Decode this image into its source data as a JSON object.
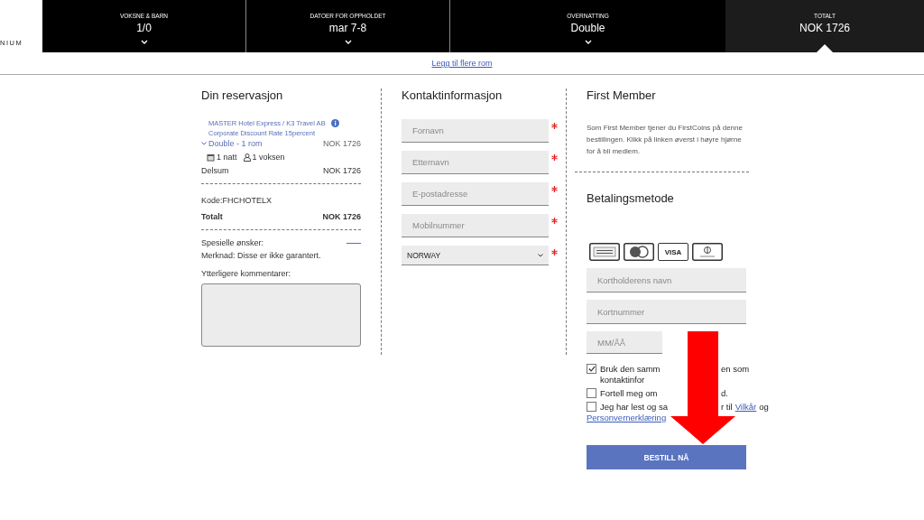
{
  "header": {
    "logo_text": "NIUM",
    "items": [
      {
        "label": "VOKSNE & BARN",
        "value": "1/0",
        "kind": "dropdown"
      },
      {
        "label": "DATOER FOR OPPHOLDET",
        "value": "mar 7-8",
        "kind": "dropdown"
      },
      {
        "label": "OVERNATTING",
        "value": "Double",
        "kind": "dropdown"
      },
      {
        "label": "TOTALT",
        "value": "NOK 1726",
        "kind": "total"
      }
    ]
  },
  "add_room_link": "Legg til flere rom",
  "reservation": {
    "title": "Din reservasjon",
    "rate_line_1": "MASTER Hotel Express / K3 Travel AB",
    "rate_line_2": "Corporate Discount Rate 15percent",
    "room": "Double - 1 rom",
    "room_price": "NOK 1726",
    "nights": "1 natt",
    "guests": "1 voksen",
    "subtotal_label": "Delsum",
    "subtotal": "NOK 1726",
    "code": "Kode:FHCHOTELX",
    "total_label": "Totalt",
    "total": "NOK 1726",
    "special_requests": "Spesielle ønsker:",
    "note": "Merknad: Disse er ikke garantert.",
    "comments_label": "Ytterligere kommentarer:"
  },
  "contact": {
    "title": "Kontaktinformasjon",
    "fields": [
      {
        "kind": "input",
        "placeholder": "Fornavn",
        "required": true
      },
      {
        "kind": "input",
        "placeholder": "Etternavn",
        "required": true
      },
      {
        "kind": "input",
        "placeholder": "E-postadresse",
        "required": true
      },
      {
        "kind": "input",
        "placeholder": "Mobilnummer",
        "required": true
      },
      {
        "kind": "select",
        "value": "NORWAY",
        "required": true
      }
    ]
  },
  "member": {
    "title": "First Member",
    "text": "Som First Member tjener du FirstCoins på denne bestillingen. Klikk på linken øverst i høyre hjørne for å bli medlem."
  },
  "payment": {
    "title": "Betalingsmetode",
    "cards": [
      {
        "kind": "amex"
      },
      {
        "kind": "mastercard"
      },
      {
        "kind": "visa",
        "label": "VISA"
      },
      {
        "kind": "diners"
      }
    ],
    "fields": [
      {
        "placeholder": "Kortholderens navn",
        "kind": "wide"
      },
      {
        "placeholder": "Kortnummer",
        "kind": "wide"
      },
      {
        "placeholder": "MM/ÅÅ",
        "kind": "short"
      }
    ],
    "checkboxes": [
      {
        "checked": true,
        "lines": [
          {
            "pre": "Bruk den samm",
            "post": [
              {
                "text": "en som",
                "kind": "text"
              }
            ]
          },
          {
            "pre": "kontaktinfor"
          }
        ]
      },
      {
        "checked": false,
        "lines": [
          {
            "pre": "Fortell meg om",
            "post": [
              {
                "text": "d.",
                "kind": "text"
              }
            ]
          }
        ]
      },
      {
        "checked": false,
        "lines": [
          {
            "pre": "Jeg har lest og sa",
            "post": [
              {
                "text": "r til",
                "kind": "text"
              },
              {
                "text": "Vilkår",
                "kind": "link"
              },
              {
                "text": "og",
                "kind": "text"
              }
            ]
          }
        ],
        "tail": [
          {
            "text": "Personvernerklæring",
            "kind": "link"
          }
        ]
      }
    ],
    "button": "BESTILL NÅ"
  }
}
